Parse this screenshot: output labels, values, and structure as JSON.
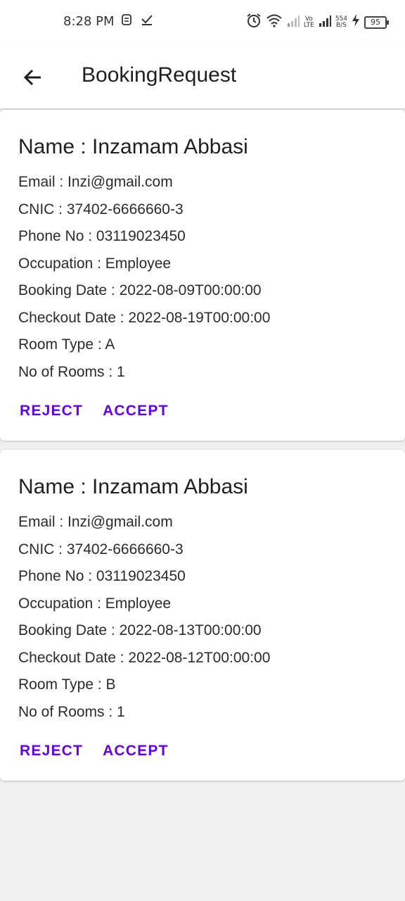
{
  "status_bar": {
    "time": "8:28 PM",
    "icons_left": [
      "notification-icon",
      "check-icon"
    ],
    "volte_top": "Vo",
    "volte_bottom": "LTE",
    "speed_top": "554",
    "speed_bottom": "B/S",
    "battery": "95"
  },
  "app_bar": {
    "title": "BookingRequest",
    "back_icon": "arrow-back-icon"
  },
  "requests": [
    {
      "name": "Name : Inzamam Abbasi",
      "email": "Email : Inzi@gmail.com",
      "cnic": "CNIC : 37402-6666660-3",
      "phone": "Phone No : 03119023450",
      "occupation": "Occupation : Employee",
      "booking_date": "Booking Date : 2022-08-09T00:00:00",
      "checkout_date": "Checkout Date : 2022-08-19T00:00:00",
      "room_type": "Room Type : A",
      "rooms": "No of Rooms : 1",
      "reject_label": "REJECT",
      "accept_label": "ACCEPT"
    },
    {
      "name": "Name : Inzamam Abbasi",
      "email": "Email : Inzi@gmail.com",
      "cnic": "CNIC : 37402-6666660-3",
      "phone": "Phone No : 03119023450",
      "occupation": "Occupation : Employee",
      "booking_date": "Booking Date : 2022-08-13T00:00:00",
      "checkout_date": "Checkout Date : 2022-08-12T00:00:00",
      "room_type": "Room Type : B",
      "rooms": "No of Rooms : 1",
      "reject_label": "REJECT",
      "accept_label": "ACCEPT"
    }
  ],
  "colors": {
    "accent": "#6200ee",
    "background": "#f0f0f0",
    "card": "#ffffff"
  }
}
